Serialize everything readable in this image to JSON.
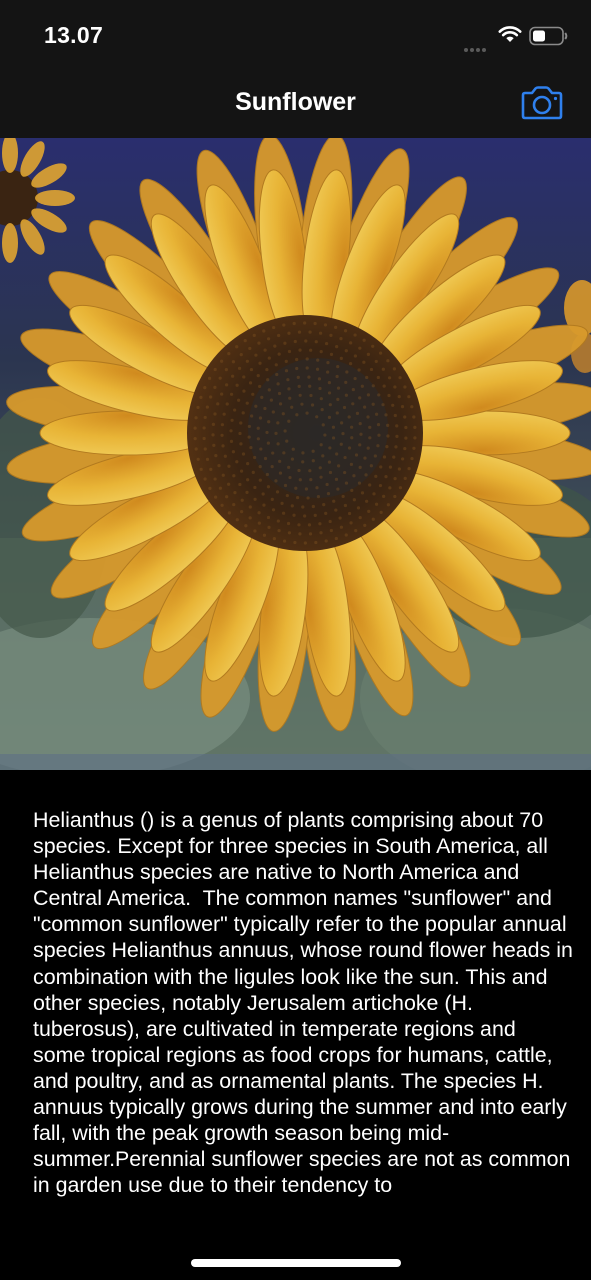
{
  "status_bar": {
    "time": "13.07",
    "icons": [
      "signal-dots-icon",
      "wifi-icon",
      "battery-icon"
    ]
  },
  "nav_bar": {
    "title": "Sunflower",
    "camera_button_icon": "camera-icon",
    "accent_color": "#2F80ED"
  },
  "photo": {
    "subject": "sunflower-photo"
  },
  "description": {
    "text": "Helianthus () is a genus of plants comprising about 70 species. Except for three species in South America, all Helianthus species are native to North America and Central America.  The common names \"sunflower\" and \"common sunflower\" typically refer to the popular annual species Helianthus annuus, whose round flower heads in combination with the ligules look like the sun. This and other species, notably Jerusalem artichoke (H. tuberosus), are cultivated in temperate regions and some tropical regions as food crops for humans, cattle, and poultry, and as ornamental plants. The species H. annuus typically grows during the summer and into early fall, with the peak growth season being mid-summer.Perennial sunflower species are not as common in garden use due to their tendency to"
  }
}
